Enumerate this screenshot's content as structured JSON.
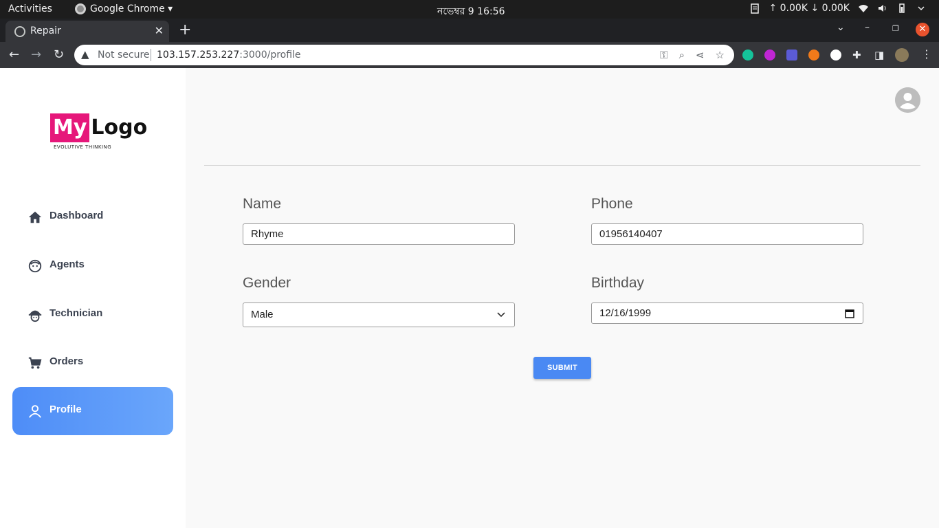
{
  "os_bar": {
    "activities": "Activities",
    "app_name": "Google Chrome ▾",
    "clock": "নভেম্বর 9  16:56",
    "net_speed": "↑ 0.00K ↓ 0.00K"
  },
  "browser": {
    "tab_title": "Repair",
    "not_secure": "Not secure",
    "url_host": "103.157.253.227",
    "url_path": ":3000/profile"
  },
  "logo": {
    "my": "My",
    "word": "Logo",
    "tagline": "EVOLUTIVE THINKING"
  },
  "sidebar": {
    "items": [
      {
        "label": "Dashboard",
        "icon": "home-icon"
      },
      {
        "label": "Agents",
        "icon": "agent-icon"
      },
      {
        "label": "Technician",
        "icon": "technician-icon"
      },
      {
        "label": "Orders",
        "icon": "cart-icon"
      },
      {
        "label": "Profile",
        "icon": "user-icon",
        "active": true
      }
    ]
  },
  "form": {
    "name_label": "Name",
    "name_value": "Rhyme",
    "phone_label": "Phone",
    "phone_value": "01956140407",
    "gender_label": "Gender",
    "gender_value": "Male",
    "birthday_label": "Birthday",
    "birthday_value": "12/16/1999",
    "submit_label": "SUBMIT"
  },
  "colors": {
    "accent": "#4a89f3",
    "logo_pink": "#e6177a"
  }
}
